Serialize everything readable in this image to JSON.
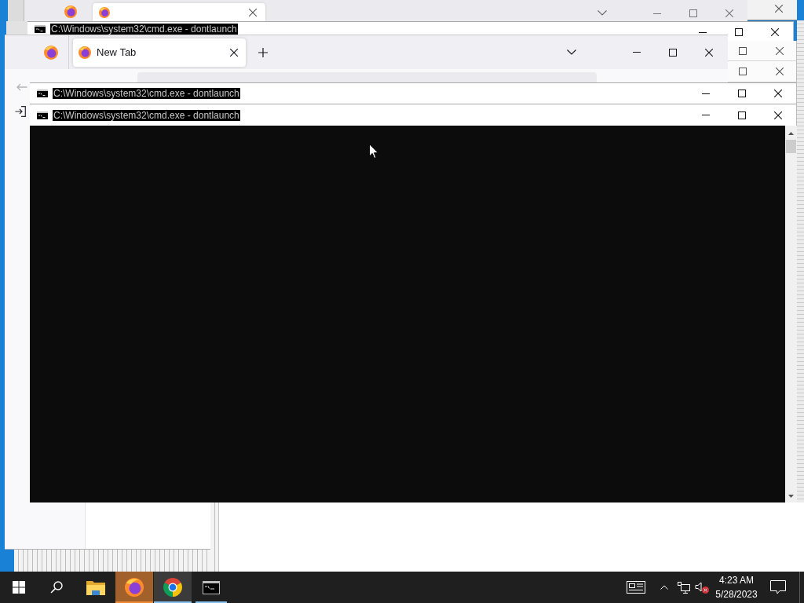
{
  "windows": [
    {
      "kind": "browser-strip",
      "tabs": [
        {
          "selected": true
        }
      ],
      "controls": [
        {
          "kind": "minimize"
        },
        {
          "kind": "maximize"
        },
        {
          "kind": "close"
        }
      ]
    },
    {
      "kind": "frame",
      "controls": [
        {
          "kind": "close"
        }
      ]
    },
    {
      "kind": "console-bar",
      "title": "C:\\Windows\\system32\\cmd.exe - dontlaunch",
      "title_highlighted": true,
      "controls": [
        {
          "kind": "minimize"
        },
        {
          "kind": "maximize"
        },
        {
          "kind": "close"
        }
      ]
    },
    {
      "kind": "browser",
      "tabs": [
        {
          "label": "New Tab",
          "selected": true
        }
      ],
      "controls": [
        {
          "kind": "minimize"
        },
        {
          "kind": "maximize"
        },
        {
          "kind": "close"
        }
      ]
    },
    {
      "kind": "frame",
      "controls": [
        {
          "kind": "maximize"
        },
        {
          "kind": "close"
        }
      ]
    },
    {
      "kind": "frame",
      "controls": [
        {
          "kind": "maximize"
        },
        {
          "kind": "close"
        }
      ]
    },
    {
      "kind": "console-bar",
      "title": "C:\\Windows\\system32\\cmd.exe - dontlaunch",
      "title_highlighted": true,
      "controls": [
        {
          "kind": "minimize"
        },
        {
          "kind": "maximize"
        },
        {
          "kind": "close"
        }
      ]
    },
    {
      "kind": "console",
      "title": "C:\\Windows\\system32\\cmd.exe - dontlaunch",
      "title_highlighted": true,
      "controls": [
        {
          "kind": "minimize"
        },
        {
          "kind": "maximize"
        },
        {
          "kind": "close"
        }
      ]
    }
  ],
  "taskbar": {
    "apps": [
      {
        "running": false,
        "selected": false,
        "flashing": false
      },
      {
        "running": true,
        "selected": false,
        "flashing": true
      },
      {
        "running": true,
        "selected": true,
        "flashing": false
      },
      {
        "running": true,
        "selected": false,
        "flashing": false
      }
    ],
    "tray": {
      "volume_muted": true
    },
    "clock": {
      "time": "4:23 AM",
      "date": "5/28/2023"
    }
  }
}
